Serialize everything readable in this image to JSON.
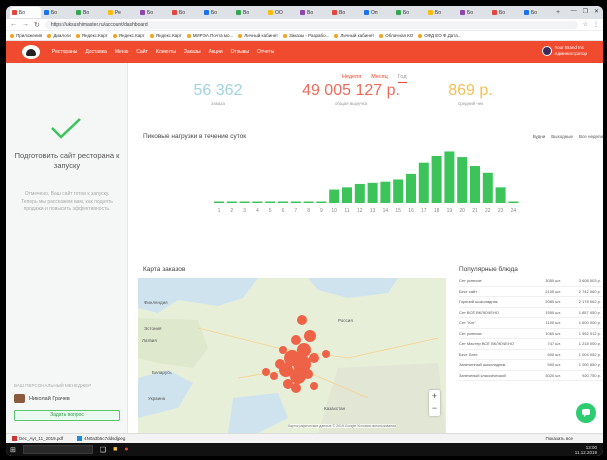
{
  "browser": {
    "tabs": [
      "Бо",
      "Бо",
      "Во",
      "Ре",
      "Бо",
      "Бо",
      "Бо",
      "Во",
      "ОО",
      "Во",
      "Во",
      "Оп",
      "Бо",
      "Бо",
      "Бо",
      "Бо",
      "Бо"
    ],
    "new_tab": "+",
    "url": "https://uksushimaster.ru/account/dashboard",
    "bookmarks": [
      "Приложения",
      "Диалоги",
      "Яндекс.Карт",
      "Яндекс.Карт",
      "Яндекс.Карт",
      "МИРЭА.Почта мо...",
      "Личный кабинет",
      "Заказы - Разрабо...",
      "Личный кабинет",
      "Облачная КО",
      "ОФД ЕО Ф.Дата..."
    ],
    "controls": [
      "—",
      "❐",
      "✕"
    ]
  },
  "header": {
    "menu": [
      "Рестораны",
      "Доставка",
      "Меню",
      "Сайт",
      "Клиенты",
      "Заказы",
      "Акции",
      "Отзывы",
      "Отчеты"
    ],
    "user_name": "Your Brand Inc",
    "user_sub": "Администратор"
  },
  "sidebar": {
    "title": "Подготовить сайт ресторана к запуску",
    "description": "Отмечено, Ваш сайт готов к запуску. Теперь мы расскажем вам, как поднять продажи и повысить эффективность.",
    "manager_caption": "ВАШ ПЕРСОНАЛЬНЫЙ МЕНЕДЖЕР",
    "manager_name": "Николай Грачев",
    "contact_button": "Задать вопрос"
  },
  "period_tabs": [
    "Неделя",
    "Месяц",
    "Год"
  ],
  "kpis": [
    {
      "value": "56 362",
      "label": "заказа",
      "color": "#9fd4dd"
    },
    {
      "value": "49 005 127 р.",
      "label": "общая выручка",
      "color": "#ef6a5a"
    },
    {
      "value": "869 р.",
      "label": "средний чек",
      "color": "#f2c055"
    }
  ],
  "chart_data": {
    "type": "bar",
    "title": "Пиковые нагрузки в течение суток",
    "categories": [
      "1",
      "2",
      "3",
      "4",
      "5",
      "6",
      "7",
      "8",
      "9",
      "10",
      "11",
      "12",
      "13",
      "14",
      "15",
      "16",
      "17",
      "18",
      "19",
      "20",
      "21",
      "22",
      "23",
      "24"
    ],
    "values": [
      1,
      1,
      1,
      1,
      1,
      1,
      1,
      1,
      1,
      12,
      14,
      17,
      18,
      19,
      21,
      26,
      36,
      42,
      46,
      41,
      33,
      27,
      14,
      1
    ],
    "ylim": [
      0,
      50
    ],
    "color": "#3cc45a",
    "toggles": [
      "Будни",
      "Выходные",
      "Все недели"
    ]
  },
  "map": {
    "title": "Карта заказов",
    "labels": [
      "Финляндия",
      "Эстония",
      "Латвия",
      "Беларусь",
      "Украина",
      "Казахстан",
      "Россия"
    ],
    "zoom_in": "+",
    "zoom_out": "−",
    "attribution": "Картографические данные © 2019 Google  Условия использования"
  },
  "popular": {
    "title": "Популярные блюда",
    "rows": [
      {
        "name": "Сет успехов",
        "qty": "3050 шт.",
        "sum": "3 608 003 р."
      },
      {
        "name": "Бест сайт",
        "qty": "2105 шт.",
        "sum": "2 742 060 р."
      },
      {
        "name": "Горячий шоколадник",
        "qty": "2080 шт.",
        "sum": "2 178 062 р."
      },
      {
        "name": "Сет ВСЁ ВКЛЮЧЕНО",
        "qty": "1550 шт.",
        "sum": "1 857 050 р."
      },
      {
        "name": "Сет \"Кот\"",
        "qty": "1100 шт.",
        "sum": "1 600 000 р."
      },
      {
        "name": "Сет успехов",
        "qty": "1060 шт.",
        "sum": "1 592 012 р."
      },
      {
        "name": "Сет Мастер ВСЁ ВКЛЮЧЕНО",
        "qty": "747 шт.",
        "sum": "1 218 000 р."
      },
      {
        "name": "Бест Лате",
        "qty": "600 шт.",
        "sum": "1 004 052 р."
      },
      {
        "name": "Запеченный шоколадник",
        "qty": "590 шт.",
        "sum": "1 000 650 р."
      },
      {
        "name": "Запеченый классический",
        "qty": "3020 шт.",
        "sum": "920 750 р."
      }
    ]
  },
  "downloads": [
    "Dec_Ayt_11_2019.pdf",
    "4N0a3b5c7ddsdjpeg"
  ],
  "downloads_all": "Показать все",
  "taskbar": {
    "search": "",
    "clock": "13:00\n11.12.2019"
  }
}
